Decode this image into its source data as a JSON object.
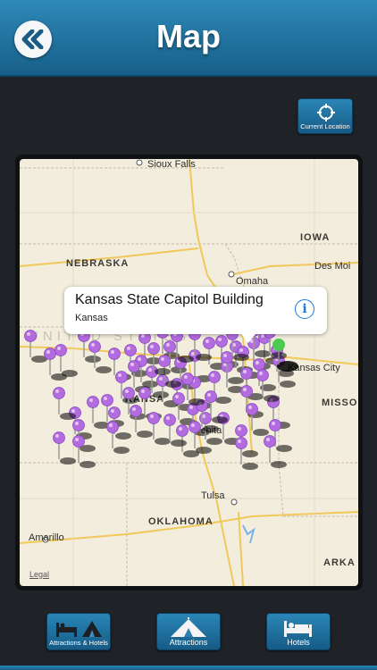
{
  "header": {
    "title": "Map",
    "back_icon": "back-chevrons-icon"
  },
  "toolbar_top": {
    "current_location_label": "Current Location",
    "icon": "crosshair-icon"
  },
  "map": {
    "labels": {
      "sioux_falls": "Sioux Falls",
      "iowa": "IOWA",
      "nebraska": "NEBRASKA",
      "omaha": "Omaha",
      "des_moines": "Des Moi",
      "united_states": "UNITED STATES",
      "kansas": "KANSA",
      "kansas_city": "Kansas City",
      "missouri": "MISSO",
      "wichita": "chita",
      "tulsa": "Tulsa",
      "oklahoma": "OKLAHOMA",
      "amarillo": "Amarillo",
      "arkansas": "ARKA",
      "legal": "Legal"
    },
    "pin_color": "#b36be0",
    "selected_pin_color": "#4cc94f"
  },
  "callout": {
    "title": "Kansas State Capitol Building",
    "subtitle": "Kansas",
    "info_icon": "info-icon"
  },
  "bottom_tabs": [
    {
      "label": "Attractions & Hotels",
      "icon": "bed-tent-icon"
    },
    {
      "label": "Attractions",
      "icon": "tent-icon"
    },
    {
      "label": "Hotels",
      "icon": "bed-icon"
    }
  ],
  "colors": {
    "header": "#2483b3",
    "background": "#1f2226",
    "map_land": "#f2eddc"
  }
}
